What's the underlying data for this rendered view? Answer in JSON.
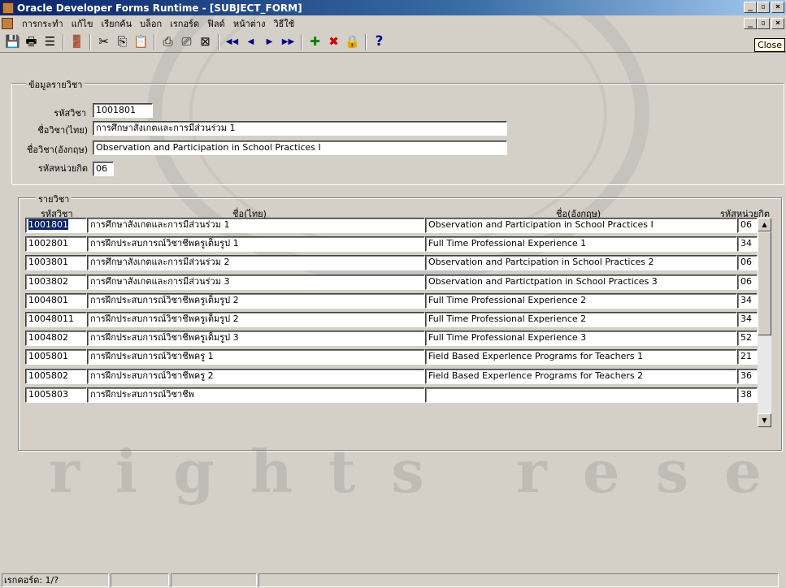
{
  "window": {
    "title": "Oracle Developer Forms Runtime - [SUBJECT_FORM]",
    "min_label": "_",
    "max_label": "▫",
    "close_label": "×"
  },
  "menu": {
    "items": [
      "การกระทำ",
      "แก้ไข",
      "เรียกค้น",
      "บล็อก",
      "เรกอร์ด",
      "ฟิลด์",
      "หน้าต่าง",
      "วิธีใช้"
    ]
  },
  "tooltip": {
    "text": "Close"
  },
  "toolbar": {
    "buttons": [
      {
        "icon": "save-icon",
        "glyph": "💾"
      },
      {
        "icon": "print-icon",
        "glyph": "🖶"
      },
      {
        "icon": "print-setup-icon",
        "glyph": "☰"
      },
      {
        "icon": "exit-icon",
        "glyph": "🚪"
      },
      {
        "icon": "cut-icon",
        "glyph": "✂"
      },
      {
        "icon": "copy-icon",
        "glyph": "⎘"
      },
      {
        "icon": "paste-icon",
        "glyph": "📋"
      },
      {
        "icon": "query-enter-icon",
        "glyph": "⎙"
      },
      {
        "icon": "query-execute-icon",
        "glyph": "⎚"
      },
      {
        "icon": "query-cancel-icon",
        "glyph": "⊠"
      },
      {
        "icon": "first-record-icon",
        "glyph": "◀◀"
      },
      {
        "icon": "previous-record-icon",
        "glyph": "◀"
      },
      {
        "icon": "next-record-icon",
        "glyph": "▶"
      },
      {
        "icon": "last-record-icon",
        "glyph": "▶▶"
      },
      {
        "icon": "insert-record-icon",
        "glyph": "✚"
      },
      {
        "icon": "delete-record-icon",
        "glyph": "✖"
      },
      {
        "icon": "lock-record-icon",
        "glyph": "🔒"
      },
      {
        "icon": "help-icon",
        "glyph": "?"
      }
    ],
    "colors": {
      "nav": "#00008b",
      "insert": "#008000",
      "delete": "#cc0000",
      "help": "#000080"
    }
  },
  "detail": {
    "group_label": "ข้อมูลรายวิชา",
    "code_label": "รหัสวิชา",
    "code_value": "1001801",
    "name_th_label": "ชื่อวิชา(ไทย)",
    "name_th_value": "การศึกษาสังเกตและการมีส่วนร่วม 1",
    "name_en_label": "ชื่อวิชา(อังกฤษ)",
    "name_en_value": "Observation and Participation in School Practices I",
    "unit_label": "รหัสหน่วยกิต",
    "unit_value": "06"
  },
  "list": {
    "group_label": "รายวิชา",
    "headers": {
      "code": "รหัสวิชา",
      "name_th": "ชื่อ(ไทย)",
      "name_en": "ชื่อ(อังกฤษ)",
      "unit": "รหัสหน่วยกิต"
    },
    "rows": [
      {
        "code": "1001801",
        "name_th": "การศึกษาสังเกตและการมีส่วนร่วม 1",
        "name_en": "Observation and Participation in School Practices I",
        "unit": "06"
      },
      {
        "code": "1002801",
        "name_th": "การฝึกประสบการณ์วิชาชีพครูเต็มรูป 1",
        "name_en": "Full Time Professional Experience 1",
        "unit": "34"
      },
      {
        "code": "1003801",
        "name_th": "การศึกษาสังเกตและการมีส่วนร่วม 2",
        "name_en": "Observation and Partcipation in School Practices 2",
        "unit": "06"
      },
      {
        "code": "1003802",
        "name_th": "การศึกษาสังเกตและการมีส่วนร่วม 3",
        "name_en": "Observation and Partictpation in School Practices 3",
        "unit": "06"
      },
      {
        "code": "1004801",
        "name_th": "การฝึกประสบการณ์วิชาชีพครูเต็มรูป 2",
        "name_en": "Full Time Professional Experience 2",
        "unit": "34"
      },
      {
        "code": "10048011",
        "name_th": "การฝึกประสบการณ์วิชาชีพครูเต็มรูป 2",
        "name_en": "Full Time Professional Experience 2",
        "unit": "34"
      },
      {
        "code": "1004802",
        "name_th": "การฝึกประสบการณ์วิชาชีพครูเต็มรูป 3",
        "name_en": "Full Time Professional Experience 3",
        "unit": "52"
      },
      {
        "code": "1005801",
        "name_th": "การฝึกประสบการณ์วิชาชีพครู 1",
        "name_en": "Field Based Experlence Programs for Teachers 1",
        "unit": "21"
      },
      {
        "code": "1005802",
        "name_th": "การฝึกประสบการณ์วิชาชีพครู 2",
        "name_en": "Field Based Experlence Programs for Teachers 2",
        "unit": "36"
      },
      {
        "code": "1005803",
        "name_th": "การฝึกประสบการณ์วิชาชีพ",
        "name_en": "",
        "unit": "38"
      }
    ]
  },
  "status": {
    "record": "เรกคอร์ด: 1/?"
  },
  "watermark": {
    "text": "rights reserved"
  }
}
